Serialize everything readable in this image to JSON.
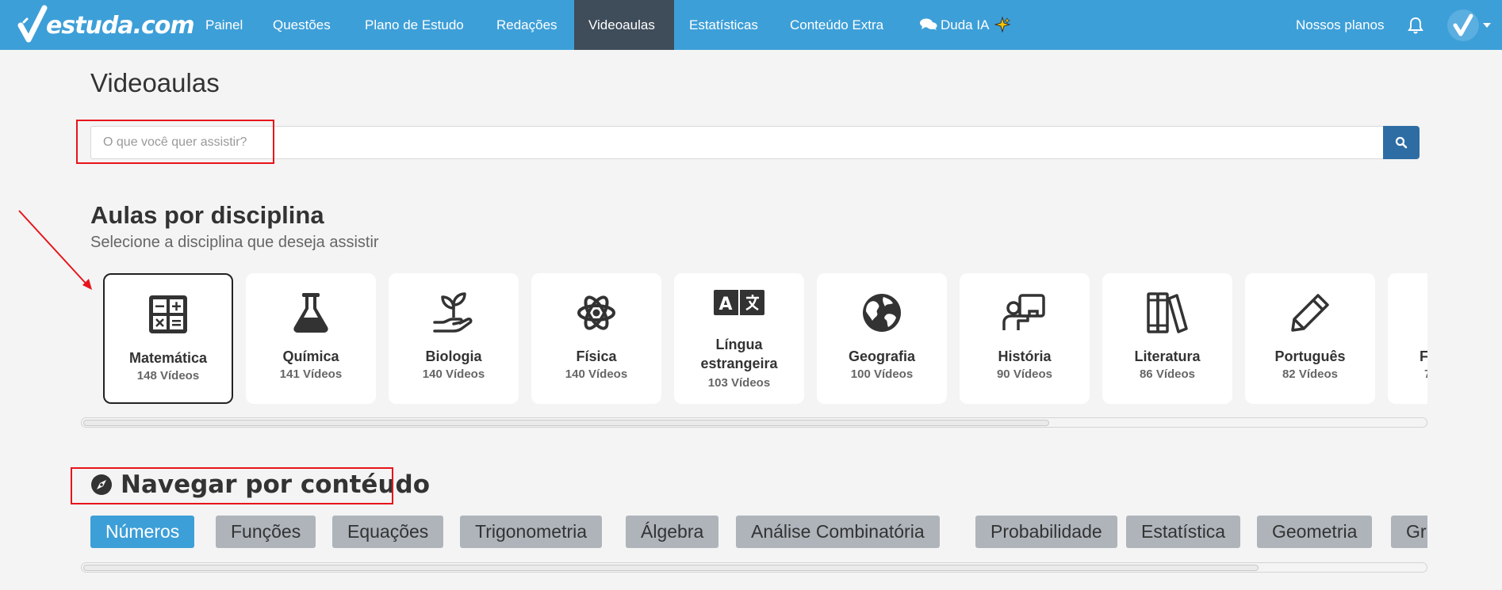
{
  "brand": {
    "name": "estuda.com"
  },
  "nav": {
    "items": [
      {
        "label": "Painel"
      },
      {
        "label": "Questões"
      },
      {
        "label": "Plano de Estudo"
      },
      {
        "label": "Redações"
      },
      {
        "label": "Videoaulas"
      },
      {
        "label": "Estatísticas"
      },
      {
        "label": "Conteúdo Extra"
      },
      {
        "label": "Duda IA"
      }
    ],
    "active_label": "Videoaulas",
    "plans_label": "Nossos planos"
  },
  "page": {
    "title": "Videoaulas"
  },
  "search": {
    "placeholder": "O que você quer assistir?"
  },
  "disciplines": {
    "title": "Aulas por disciplina",
    "subtitle": "Selecione a disciplina que deseja assistir",
    "selected": "Matemática",
    "items": [
      {
        "name": "Matemática",
        "count": "148 Vídeos",
        "icon": "calculator-icon"
      },
      {
        "name": "Química",
        "count": "141 Vídeos",
        "icon": "flask-icon"
      },
      {
        "name": "Biologia",
        "count": "140 Vídeos",
        "icon": "seedling-hand-icon"
      },
      {
        "name": "Física",
        "count": "140 Vídeos",
        "icon": "atom-icon"
      },
      {
        "name": "Língua estrangeira",
        "count": "103 Vídeos",
        "icon": "language-icon"
      },
      {
        "name": "Geografia",
        "count": "100 Vídeos",
        "icon": "globe-icon"
      },
      {
        "name": "História",
        "count": "90 Vídeos",
        "icon": "teacher-board-icon"
      },
      {
        "name": "Literatura",
        "count": "86 Vídeos",
        "icon": "books-icon"
      },
      {
        "name": "Português",
        "count": "82 Vídeos",
        "icon": "pencil-icon"
      },
      {
        "name": "F",
        "count": "7",
        "icon": "partial-icon"
      }
    ]
  },
  "content_nav": {
    "title": "Navegar por contéudo",
    "icon": "compass-icon",
    "active": "Números",
    "pills": [
      {
        "label": "Números"
      },
      {
        "label": "Funções"
      },
      {
        "label": "Equações"
      },
      {
        "label": "Trigonometria"
      },
      {
        "label": "Álgebra"
      },
      {
        "label": "Análise Combinatória"
      },
      {
        "label": "Probabilidade"
      },
      {
        "label": "Estatística"
      },
      {
        "label": "Geometria"
      },
      {
        "label": "Gr"
      }
    ]
  },
  "colors": {
    "navbar": "#3d9fd8",
    "nav_active": "#3f4c5a",
    "search_button": "#2e6da4",
    "pill_active": "#3d9fd8",
    "pill_inactive": "#aeb4ba",
    "annotation_red": "#e8131b"
  }
}
